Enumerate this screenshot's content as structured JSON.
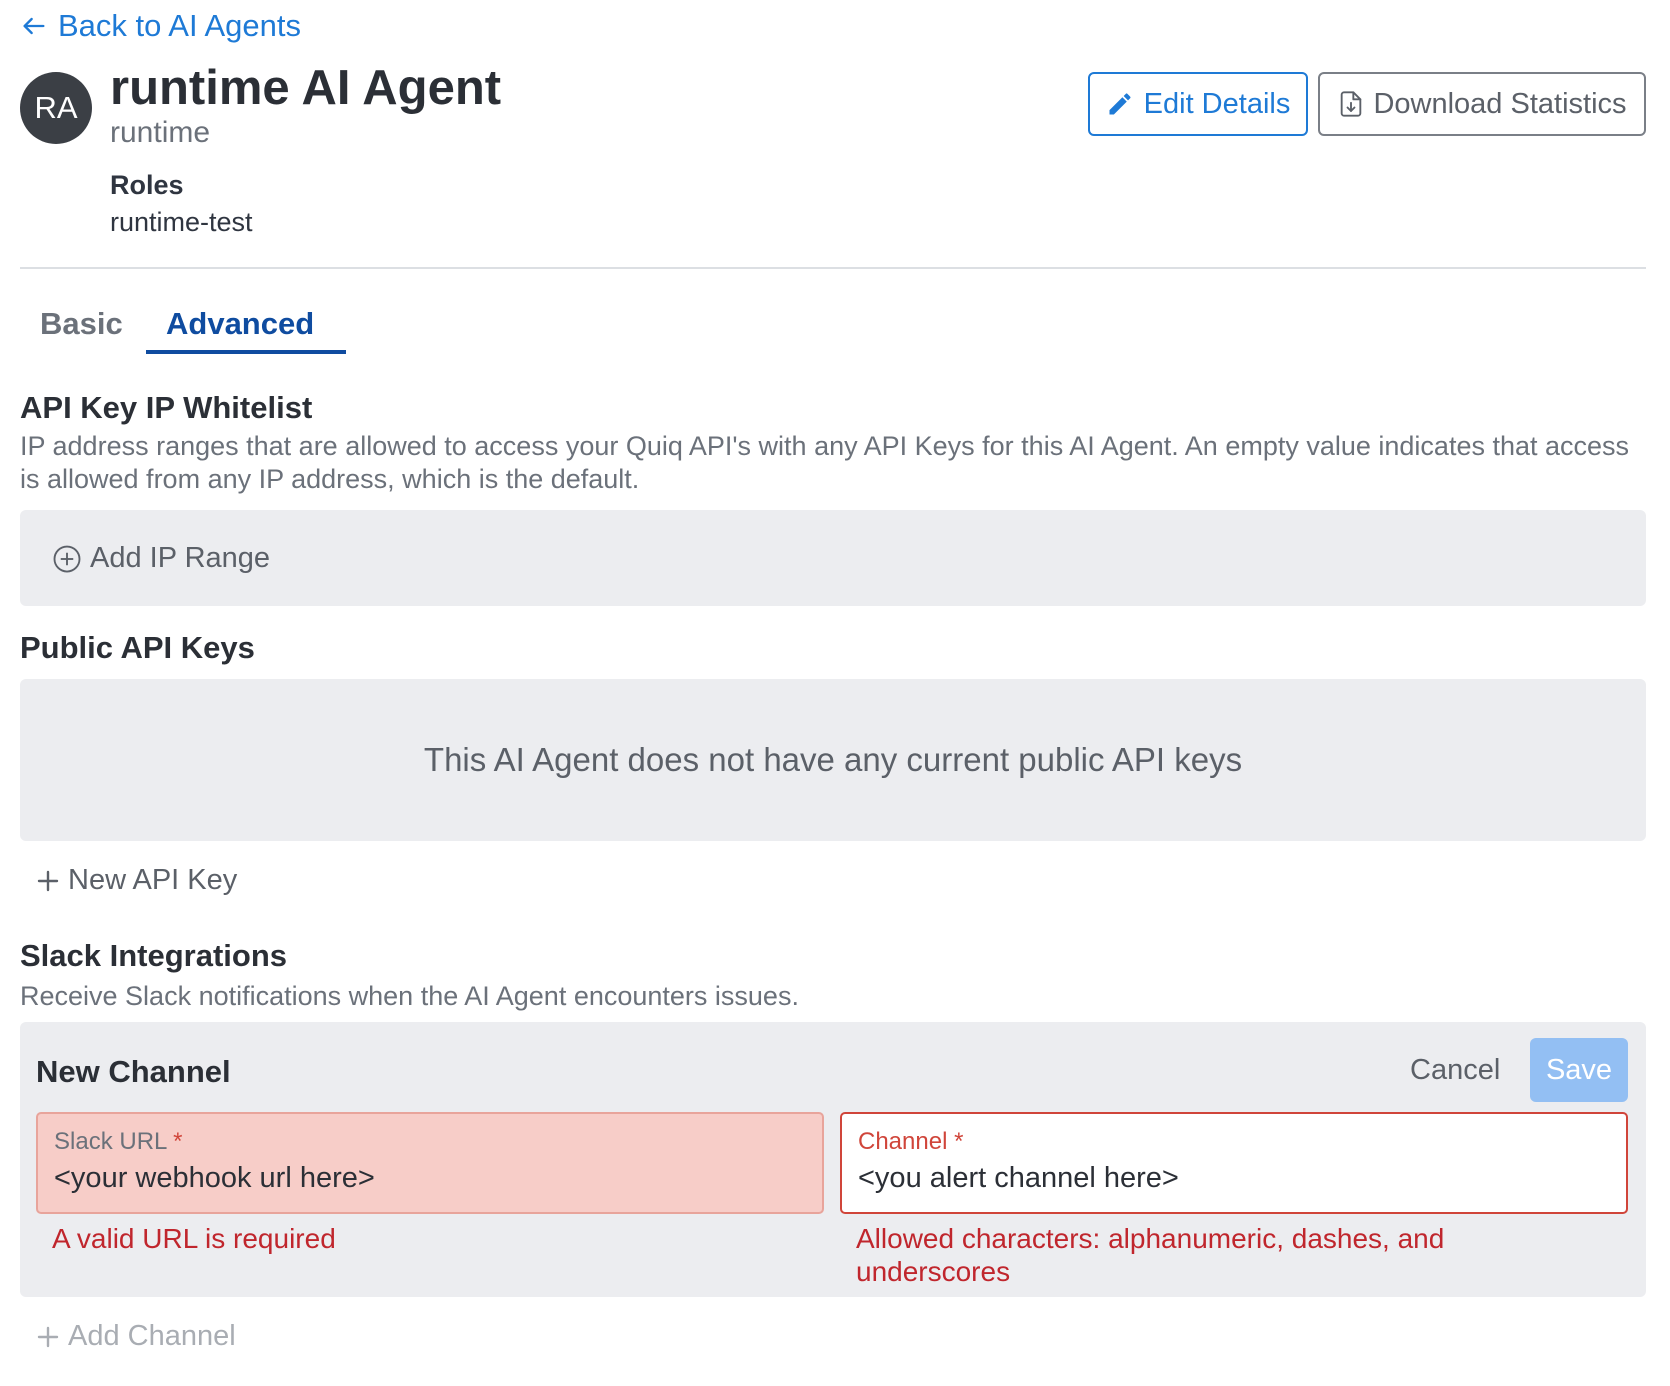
{
  "nav": {
    "back_label": "Back to AI Agents"
  },
  "agent": {
    "avatar_initials": "RA",
    "name": "runtime AI Agent",
    "subtitle": "runtime",
    "roles_label": "Roles",
    "roles_value": "runtime-test"
  },
  "header_buttons": {
    "edit_label": "Edit Details",
    "download_label": "Download Statistics"
  },
  "tabs": [
    {
      "label": "Basic",
      "active": false
    },
    {
      "label": "Advanced",
      "active": true
    }
  ],
  "ip_whitelist": {
    "title": "API Key IP Whitelist",
    "description": "IP address ranges that are allowed to access your Quiq API's with any API Keys for this AI Agent. An empty value indicates that access is allowed from any IP address, which is the default.",
    "add_label": "Add IP Range"
  },
  "public_keys": {
    "title": "Public API Keys",
    "empty_text": "This AI Agent does not have any current public API keys",
    "new_key_label": "New API Key"
  },
  "slack": {
    "title": "Slack Integrations",
    "description": "Receive Slack notifications when the AI Agent encounters issues.",
    "new_channel": {
      "title": "New Channel",
      "cancel_label": "Cancel",
      "save_label": "Save",
      "url_field": {
        "label": "Slack URL",
        "required_mark": "*",
        "value": "<your webhook url here>",
        "error": "A valid URL is required"
      },
      "channel_field": {
        "label": "Channel",
        "required_mark": "*",
        "value": "<you alert channel here>",
        "error": "Allowed characters: alphanumeric, dashes, and underscores"
      }
    },
    "add_channel_label": "Add Channel"
  },
  "colors": {
    "link_blue": "#1e7ad6",
    "active_tab": "#0f4ca0",
    "error_red": "#c0262d",
    "panel_bg": "#ecedf0",
    "save_disabled": "#93bff3"
  }
}
